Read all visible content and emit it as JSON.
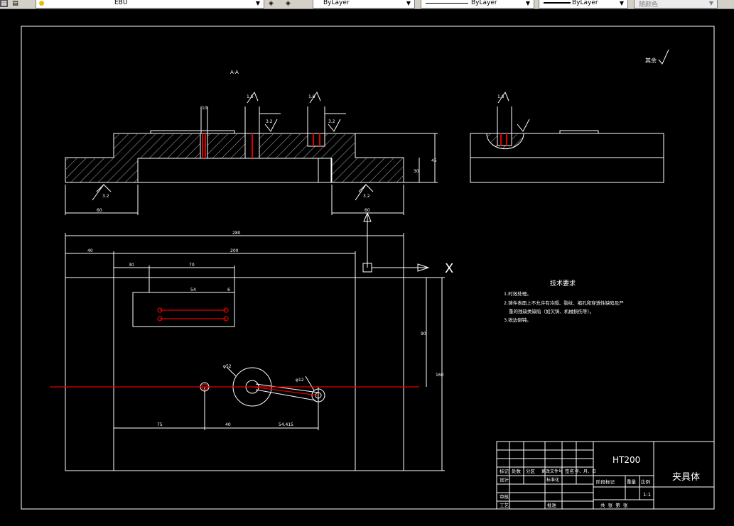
{
  "toolbar": {
    "layer_name": "EBU",
    "color_value": "ByLayer",
    "linetype_value": "ByLayer",
    "lineweight_value": "ByLayer",
    "plotstyle_value": "随颜色"
  },
  "drawing": {
    "section_label": "A-A",
    "surface_rest_label": "其余",
    "tech_title": "技术要求",
    "tech_notes": [
      "1.时效处理。",
      "2.铸件表面上不允许有冷隔、裂纹、缩孔和穿透性缺陷及严",
      "重的残缺类缺陷（如欠铸、机械损伤等）。",
      "3.锐边倒钝。"
    ],
    "dims": {
      "d_280": "280",
      "d_200": "200",
      "d_40": "40",
      "d_30": "30",
      "d_70": "70",
      "d_54": "54",
      "d_6": "6",
      "d_75": "75",
      "d_40b": "40",
      "d_54_415": "54.415",
      "d_phi52": "φ52",
      "d_phi12": "φ12",
      "d_90": "90",
      "d_160": "160",
      "d_60": "60",
      "d_30b": "30",
      "d_45": "45",
      "d_10": "10",
      "d_3_2a": "3.2",
      "d_3_2b": "3.2",
      "d_3_2c": "3.2",
      "d_3_2d": "3.2",
      "d_1_6a": "1.6",
      "d_1_6b": "1.6",
      "d_1_6c": "1.6"
    },
    "ucs_x": "X"
  },
  "title_block": {
    "material": "HT200",
    "part_name": "夹具体",
    "scale": "1:1",
    "headers": [
      "标记",
      "处数",
      "分区",
      "更改文件号",
      "签名",
      "年、月、日"
    ],
    "labels": {
      "design": "设计",
      "standard": "标准化",
      "review": "审核",
      "process": "工艺",
      "approve": "批准",
      "stage_mark": "阶段标记",
      "weight": "重量",
      "ratio": "比例",
      "sheets": "共  张  第  张"
    }
  }
}
